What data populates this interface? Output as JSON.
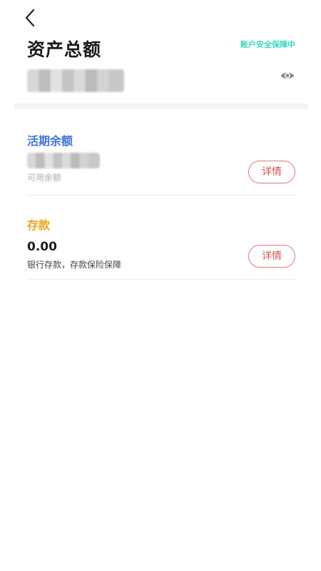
{
  "header": {
    "title": "资产总额",
    "security_text": "账户安全保障中"
  },
  "icons": {
    "back": "chevron-left-icon",
    "visibility": "eye-icon"
  },
  "current_account": {
    "title": "活期余额",
    "available_label": "可用余额",
    "detail_label": "详情"
  },
  "deposit": {
    "title": "存款",
    "amount": "0.00",
    "description": "银行存款，存款保险保障",
    "detail_label": "详情"
  },
  "colors": {
    "security_accent": "#38d9bf",
    "current_title": "#3f72d8",
    "deposit_title": "#f0a21e",
    "detail_button": "#d9534f"
  }
}
